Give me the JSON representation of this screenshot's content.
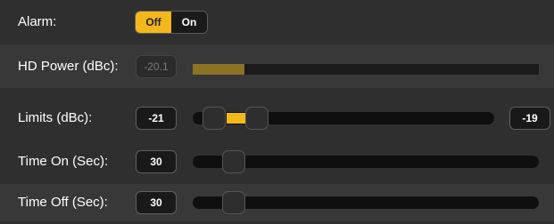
{
  "rows": {
    "alarm": {
      "label": "Alarm:",
      "off_label": "Off",
      "on_label": "On",
      "selected": "Off"
    },
    "hd_power": {
      "label": "HD Power (dBc):",
      "value": "-20.1",
      "meter_level_fraction": 0.15
    },
    "limits": {
      "label": "Limits (dBc):",
      "low": "-21",
      "high": "-19"
    },
    "time_on": {
      "label": "Time On (Sec):",
      "value": "30"
    },
    "time_off": {
      "label": "Time Off (Sec):",
      "value": "30"
    }
  },
  "colors": {
    "accent": "#f5b81c",
    "background": "#2f2f2f",
    "meter_fill": "#8a7424"
  }
}
